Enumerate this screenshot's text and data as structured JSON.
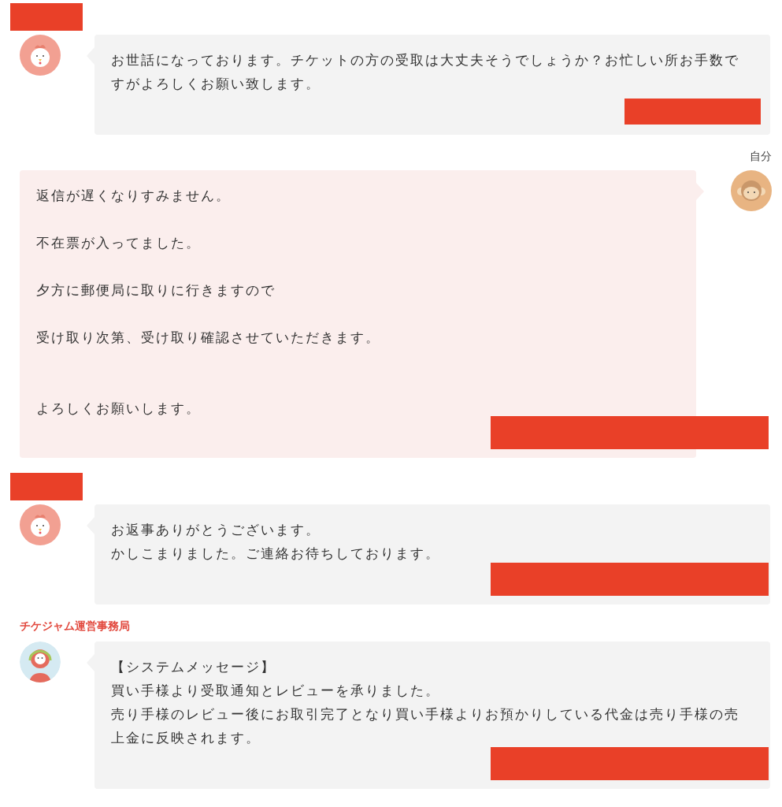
{
  "messages": [
    {
      "kind": "other",
      "avatar": {
        "kind": "chicken"
      },
      "redaction": {
        "kind": "short"
      },
      "lines": [
        {
          "text": "お世話になっております。チケットの方の受取は大丈夫そうでしょうか？お忙しい所お手数ですがよろしくお願い致します。",
          "kind": "plain"
        }
      ]
    },
    {
      "kind": "self",
      "avatar": {
        "kind": "monkey"
      },
      "label": "自分",
      "redaction": {
        "kind": "long"
      },
      "lines": [
        {
          "text": "返信が遅くなりすみません。",
          "kind": "plain"
        },
        {
          "text": "不在票が入ってました。",
          "kind": "spaced"
        },
        {
          "text": "夕方に郵便局に取りに行きますので",
          "kind": "spaced"
        },
        {
          "text": "受け取り次第、受け取り確認させていただきます。",
          "kind": "spaced"
        },
        {
          "text": "よろしくお願いします。",
          "kind": "widespaced"
        }
      ]
    },
    {
      "kind": "other",
      "avatar": {
        "kind": "chicken"
      },
      "redaction": {
        "kind": "long"
      },
      "lines": [
        {
          "text": "お返事ありがとうございます。",
          "kind": "plain"
        },
        {
          "text": "かしこまりました。ご連絡お待ちしております。",
          "kind": "plain"
        }
      ]
    },
    {
      "kind": "staff",
      "avatar": {
        "kind": "staff"
      },
      "label": "チケジャム運営事務局",
      "redaction": {
        "kind": "long"
      },
      "lines": [
        {
          "text": "【システムメッセージ】",
          "kind": "plain"
        },
        {
          "text": "買い手様より受取通知とレビューを承りました。",
          "kind": "plain"
        },
        {
          "text": "売り手様のレビュー後にお取引完了となり買い手様よりお預かりしている代金は売り手様の売上金に反映されます。",
          "kind": "plain"
        }
      ]
    }
  ]
}
